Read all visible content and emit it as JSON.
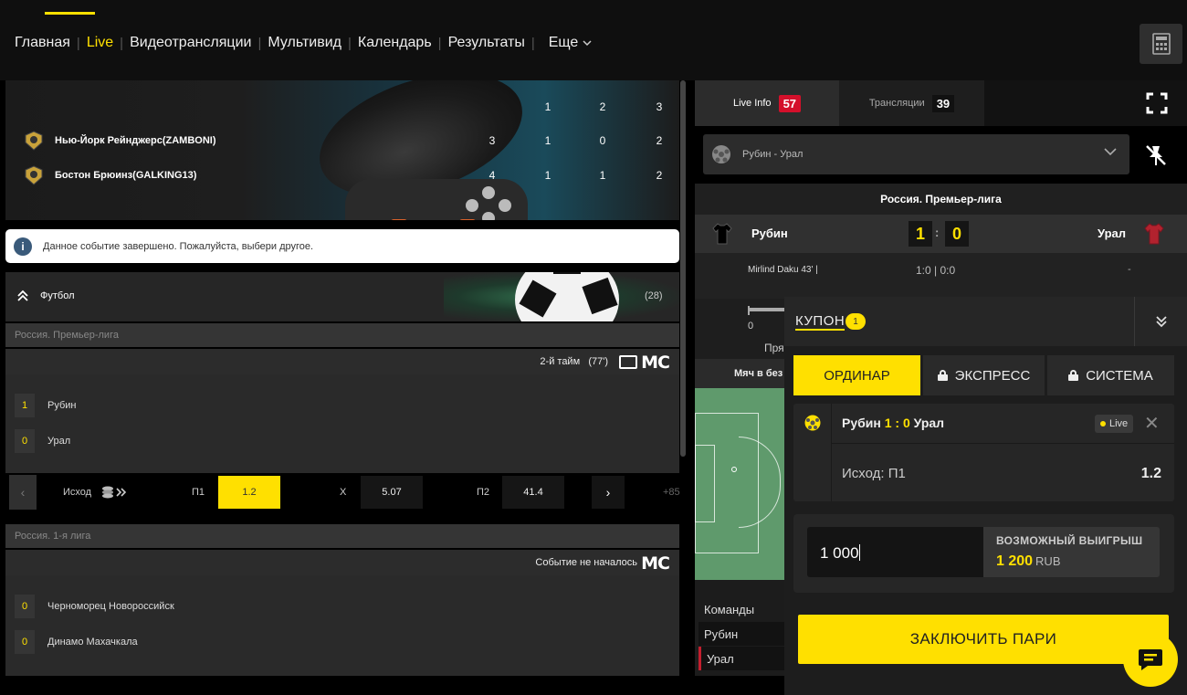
{
  "nav": {
    "items": [
      "Главная",
      "Live",
      "Видеотрансляции",
      "Мультивид",
      "Календарь",
      "Результаты"
    ],
    "active_index": 1,
    "more_label": "Еще"
  },
  "icons": {
    "calculator": "calculator-icon",
    "fullscreen": "fullscreen-icon",
    "pin": "unpin-icon",
    "chat": "chat-icon"
  },
  "colors": {
    "accent": "#ffe000",
    "live_badge": "#d4102b",
    "background": "#000000"
  },
  "hero": {
    "periods": [
      "1",
      "2",
      "3"
    ],
    "teams": [
      {
        "name": "Нью-Йорк Рейнджерс(ZAMBONI)",
        "total": "3",
        "p1": "1",
        "p2": "0",
        "p3": "2"
      },
      {
        "name": "Бостон Брюинз(GALKING13)",
        "total": "4",
        "p1": "1",
        "p2": "1",
        "p3": "2"
      }
    ]
  },
  "notice": {
    "icon": "i",
    "text": "Данное событие завершено. Пожалуйста, выбери другое."
  },
  "sport": {
    "name": "Футбол",
    "count": "(28)"
  },
  "leagues": [
    {
      "name": "Россия. Премьер-лига",
      "status": "2-й тайм",
      "minute": "(77')",
      "mc": "MC",
      "teams": [
        {
          "score": "1",
          "name": "Рубин"
        },
        {
          "score": "0",
          "name": "Урал"
        }
      ],
      "market": "Исход",
      "odds": [
        {
          "label": "П1",
          "value": "1.2"
        },
        {
          "label": "X",
          "value": "5.07"
        },
        {
          "label": "П2",
          "value": "41.4"
        }
      ],
      "more": "+85"
    },
    {
      "name": "Россия. 1-я лига",
      "status": "Событие не началось",
      "mc": "MC",
      "teams": [
        {
          "score": "0",
          "name": "Черноморец Новороссийск"
        },
        {
          "score": "0",
          "name": "Динамо Махачкала"
        }
      ]
    }
  ],
  "right": {
    "tabs": [
      {
        "label": "Live Info",
        "count": "57"
      },
      {
        "label": "Трансляции",
        "count": "39"
      }
    ],
    "selected_match": "Рубин - Урал",
    "league": "Россия. Премьер-лига",
    "home": "Рубин",
    "away": "Урал",
    "home_score": "1",
    "away_score": "0",
    "colon": ":",
    "event": {
      "text": "Mirlind Daku 43' |",
      "score": "1:0 | 0:0",
      "dash": "-"
    },
    "timeline_zero": "0",
    "timeline_text": "Пря",
    "field_head": "Мяч в без",
    "teams_title": "Команды",
    "teams_list": [
      "Рубин",
      "Урал"
    ]
  },
  "coupon": {
    "title": "КУПОН",
    "count": "1",
    "tabs": [
      "ОРДИНАР",
      "ЭКСПРЕСС",
      "СИСТЕМА"
    ],
    "bet": {
      "home": "Рубин",
      "score": "1 : 0",
      "away": "Урал",
      "live": "Live",
      "outcome": "Исход: П1",
      "odd": "1.2"
    },
    "stake": "1 000",
    "win_label": "ВОЗМОЖНЫЙ ВЫИГРЫШ",
    "win_value": "1 200",
    "win_currency": "RUB",
    "submit": "ЗАКЛЮЧИТЬ ПАРИ"
  }
}
